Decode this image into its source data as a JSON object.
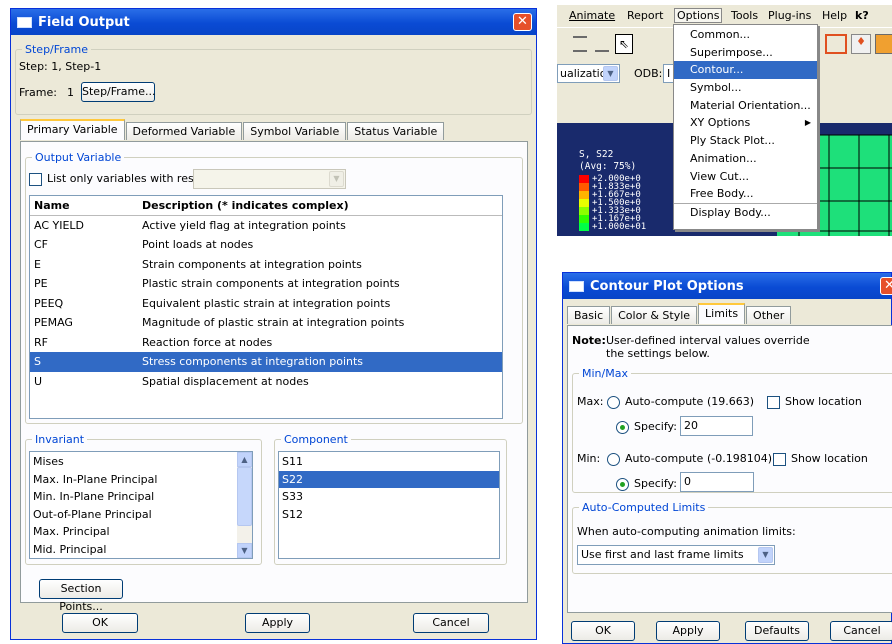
{
  "field_output": {
    "title": "Field Output",
    "close_glyph": "✕",
    "step_frame": {
      "label": "Step/Frame",
      "step_text": "Step:  1, Step-1",
      "frame_label": "Frame:",
      "frame_value": "1",
      "button": "Step/Frame..."
    },
    "tabs": [
      "Primary Variable",
      "Deformed Variable",
      "Symbol Variable",
      "Status Variable"
    ],
    "output_variable": {
      "label": "Output Variable",
      "list_only_label": "List only variables with results:",
      "header_name": "Name",
      "header_desc": "Description (* indicates complex)",
      "rows": [
        {
          "name": "AC YIELD",
          "desc": "Active yield flag at integration points"
        },
        {
          "name": "CF",
          "desc": "Point loads at nodes"
        },
        {
          "name": "E",
          "desc": "Strain components at integration points"
        },
        {
          "name": "PE",
          "desc": "Plastic strain components at integration points"
        },
        {
          "name": "PEEQ",
          "desc": "Equivalent plastic strain at integration points"
        },
        {
          "name": "PEMAG",
          "desc": "Magnitude of plastic strain at integration points"
        },
        {
          "name": "RF",
          "desc": "Reaction force at nodes"
        },
        {
          "name": "S",
          "desc": "Stress components at integration points"
        },
        {
          "name": "U",
          "desc": "Spatial displacement at nodes"
        }
      ],
      "selected_row": "S"
    },
    "invariant": {
      "label": "Invariant",
      "items": [
        "Mises",
        "Max. In-Plane Principal",
        "Min. In-Plane Principal",
        "Out-of-Plane Principal",
        "Max. Principal",
        "Mid. Principal"
      ]
    },
    "component": {
      "label": "Component",
      "items": [
        "S11",
        "S22",
        "S33",
        "S12"
      ],
      "selected": "S22"
    },
    "section_points_button": "Section Points...",
    "ok": "OK",
    "apply": "Apply",
    "cancel": "Cancel"
  },
  "menu_screenshot": {
    "menubar": [
      "Animate",
      "Report",
      "Options",
      "Tools",
      "Plug-ins",
      "Help",
      "k?"
    ],
    "dropdown_items": [
      "Common...",
      "Superimpose...",
      "Contour...",
      "Symbol...",
      "Material Orientation...",
      "XY Options",
      "Ply Stack Plot...",
      "Animation...",
      "View Cut...",
      "Free Body...",
      "Display Body..."
    ],
    "highlighted": "Contour...",
    "submenu_arrow": "▶",
    "toolbar_left": "ualization",
    "odb_label": "ODB:",
    "odb_value": "I",
    "legend_title": "S, S22",
    "legend_avg": "(Avg: 75%)",
    "legend_values": [
      "+2.000e+0",
      "+1.833e+0",
      "+1.667e+0",
      "+1.500e+0",
      "+1.333e+0",
      "+1.167e+0",
      "+1.000e+01"
    ],
    "legend_colors": [
      "#ff0000",
      "#ff5a00",
      "#ffb400",
      "#e8ff00",
      "#8cff00",
      "#30ff00",
      "#00ff46"
    ],
    "mesh_color": "#1ee07a"
  },
  "contour_options": {
    "title": "Contour Plot Options",
    "close_glyph": "✕",
    "tabs": [
      "Basic",
      "Color & Style",
      "Limits",
      "Other"
    ],
    "active_tab": "Limits",
    "note_bold": "Note:",
    "note_line1": "User-defined interval values override",
    "note_line2": "the settings below.",
    "minmax_label": "Min/Max",
    "max_label": "Max:",
    "auto_compute": "Auto-compute",
    "max_auto_value": "(19.663)",
    "show_location": "Show location",
    "specify": "Specify:",
    "max_specify_value": "20",
    "min_label": "Min:",
    "min_auto_value": "(-0.198104)",
    "min_specify_value": "0",
    "auto_limits_label": "Auto-Computed Limits",
    "when_label": "When auto-computing animation limits:",
    "select_value": "Use first and last frame limits",
    "ok": "OK",
    "apply": "Apply",
    "defaults": "Defaults",
    "cancel": "Cancel"
  }
}
